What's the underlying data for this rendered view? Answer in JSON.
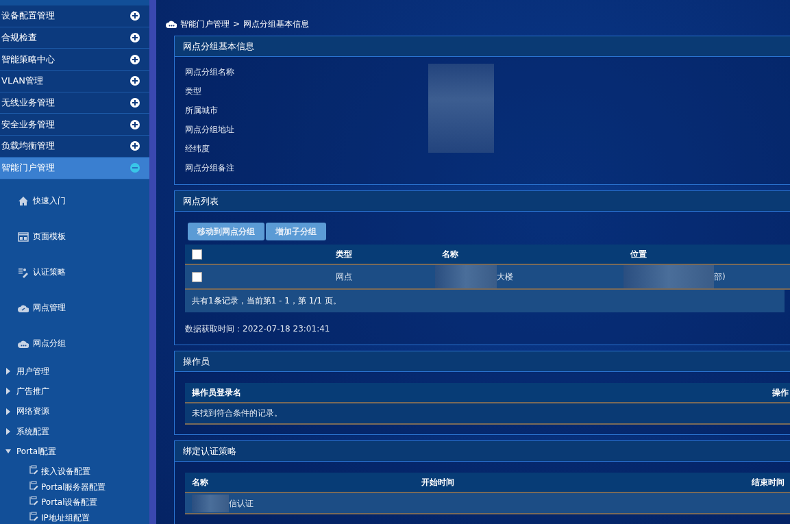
{
  "sidebar": {
    "menu": [
      {
        "label": "设备配置管理",
        "expanded": false
      },
      {
        "label": "合规检查",
        "expanded": false
      },
      {
        "label": "智能策略中心",
        "expanded": false
      },
      {
        "label": "VLAN管理",
        "expanded": false
      },
      {
        "label": "无线业务管理",
        "expanded": false
      },
      {
        "label": "安全业务管理",
        "expanded": false
      },
      {
        "label": "负载均衡管理",
        "expanded": false
      },
      {
        "label": "智能门户管理",
        "expanded": true
      }
    ],
    "submenu": [
      {
        "label": "快速入门"
      },
      {
        "label": "页面模板"
      },
      {
        "label": "认证策略"
      },
      {
        "label": "网点管理"
      },
      {
        "label": "网点分组"
      }
    ],
    "tree": [
      {
        "label": "用户管理",
        "expanded": false
      },
      {
        "label": "广告推广",
        "expanded": false
      },
      {
        "label": "网络资源",
        "expanded": false
      },
      {
        "label": "系统配置",
        "expanded": false
      },
      {
        "label": "Portal配置",
        "expanded": true,
        "children": [
          {
            "label": "接入设备配置"
          },
          {
            "label": "Portal服务器配置"
          },
          {
            "label": "Portal设备配置"
          },
          {
            "label": "IP地址组配置"
          }
        ]
      }
    ]
  },
  "breadcrumb": [
    "智能门户管理",
    "网点分组基本信息"
  ],
  "breadcrumb_separator": ">",
  "info_panel": {
    "title": "网点分组基本信息",
    "fields": [
      "网点分组名称",
      "类型",
      "所属城市",
      "网点分组地址",
      "经纬度",
      "网点分组备注"
    ]
  },
  "site_panel": {
    "title": "网点列表",
    "buttons": [
      "移动到网点分组",
      "增加子分组"
    ],
    "columns": [
      "类型",
      "名称",
      "位置"
    ],
    "header_checked": false,
    "rows": [
      {
        "checked": false,
        "type": "网点",
        "name": "大楼",
        "location": "部)"
      }
    ],
    "pager": "共有1条记录，当前第1 - 1，第 1/1 页。",
    "fetched": "数据获取时间：2022-07-18 23:01:41"
  },
  "operator_panel": {
    "title": "操作员",
    "columns": [
      "操作员登录名",
      "操作"
    ],
    "empty": "未找到符合条件的记录。"
  },
  "policy_panel": {
    "title": "绑定认证策略",
    "columns": [
      "名称",
      "开始时间",
      "结束时间"
    ],
    "rows": [
      {
        "name": "信认证"
      }
    ]
  }
}
